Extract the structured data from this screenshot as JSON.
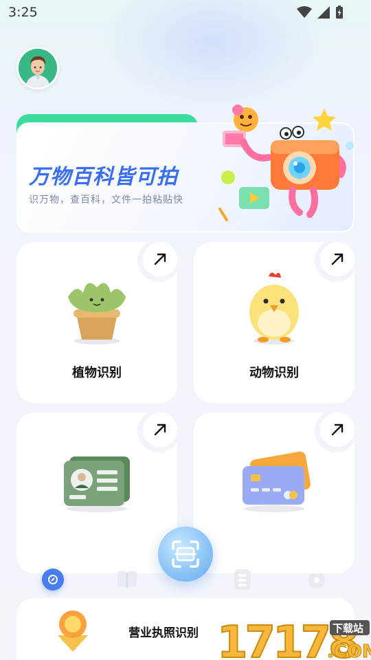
{
  "status": {
    "time": "3:25"
  },
  "banner": {
    "title": "万物百科皆可拍",
    "subtitle": "识万物，查百科，文件一拍粘贴快"
  },
  "cards": [
    {
      "label": "植物识别",
      "icon": "plant-icon"
    },
    {
      "label": "动物识别",
      "icon": "chick-icon"
    },
    {
      "label": "",
      "icon": "id-card-icon"
    },
    {
      "label": "",
      "icon": "bank-card-icon"
    }
  ],
  "peek_card": {
    "label": "营业执照识别"
  },
  "nav": {
    "items": [
      "compass-icon",
      "book-icon",
      "list-icon",
      "apple-icon"
    ]
  },
  "watermark": {
    "text": "17178",
    "suffix": ".COM",
    "tag": "下载站"
  },
  "colors": {
    "accent": "#4a7df0",
    "banner_tab": "#3edb9f",
    "title_blue": "#3a6ef2"
  }
}
